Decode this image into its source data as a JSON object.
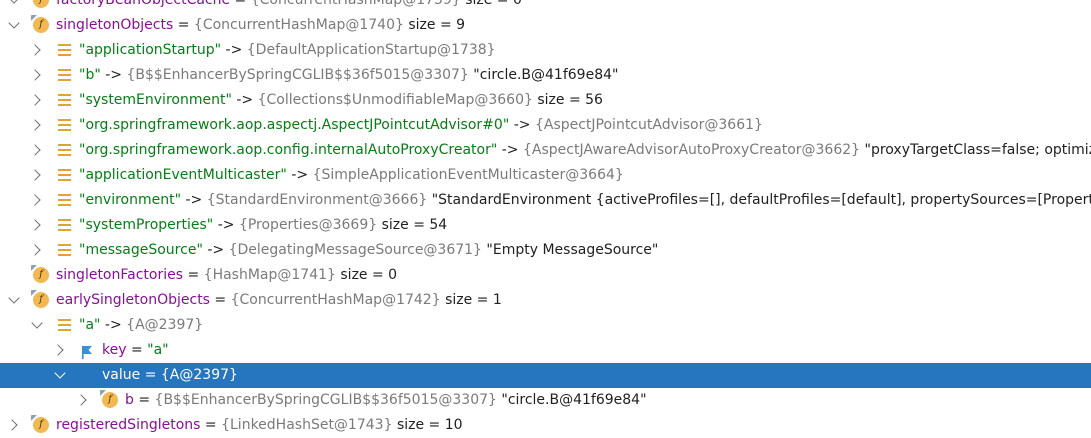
{
  "rows": [
    {
      "indent": 1,
      "arrow": "expanded",
      "icon": "field",
      "name": "factoryBeanObjectCache",
      "ref": "{ConcurrentHashMap@1739}",
      "extra": "size = 0",
      "partial": true
    },
    {
      "indent": 1,
      "arrow": "expanded",
      "icon": "field",
      "name": "singletonObjects",
      "ref": "{ConcurrentHashMap@1740}",
      "extra": "size = 9"
    },
    {
      "indent": 2,
      "arrow": "collapsed",
      "icon": "map",
      "key": "\"applicationStartup\"",
      "ref": "{DefaultApplicationStartup@1738}"
    },
    {
      "indent": 2,
      "arrow": "collapsed",
      "icon": "map",
      "key": "\"b\"",
      "ref": "{B$$EnhancerBySpringCGLIB$$36f5015@3307}",
      "extra": "\"circle.B@41f69e84\""
    },
    {
      "indent": 2,
      "arrow": "collapsed",
      "icon": "map",
      "key": "\"systemEnvironment\"",
      "ref": "{Collections$UnmodifiableMap@3660}",
      "extra": "size = 56"
    },
    {
      "indent": 2,
      "arrow": "collapsed",
      "icon": "map",
      "key": "\"org.springframework.aop.aspectj.AspectJPointcutAdvisor#0\"",
      "ref": "{AspectJPointcutAdvisor@3661}"
    },
    {
      "indent": 2,
      "arrow": "collapsed",
      "icon": "map",
      "key": "\"org.springframework.aop.config.internalAutoProxyCreator\"",
      "ref": "{AspectJAwareAdvisorAutoProxyCreator@3662}",
      "extra": "\"proxyTargetClass=false; optimize=false; opaque=false; exposeProxy=false; frozen=false\""
    },
    {
      "indent": 2,
      "arrow": "collapsed",
      "icon": "map",
      "key": "\"applicationEventMulticaster\"",
      "ref": "{SimpleApplicationEventMulticaster@3664}"
    },
    {
      "indent": 2,
      "arrow": "collapsed",
      "icon": "map",
      "key": "\"environment\"",
      "ref": "{StandardEnvironment@3666}",
      "extra": "\"StandardEnvironment {activeProfiles=[], defaultProfiles=[default], propertySources=[PropertiesPropertySource {name='systemProperties'}]}\""
    },
    {
      "indent": 2,
      "arrow": "collapsed",
      "icon": "map",
      "key": "\"systemProperties\"",
      "ref": "{Properties@3669}",
      "extra": "size = 54"
    },
    {
      "indent": 2,
      "arrow": "collapsed",
      "icon": "map",
      "key": "\"messageSource\"",
      "ref": "{DelegatingMessageSource@3671}",
      "extra": "\"Empty MessageSource\""
    },
    {
      "indent": 1,
      "arrow": "none",
      "icon": "field",
      "name": "singletonFactories",
      "ref": "{HashMap@1741}",
      "extra": "size = 0"
    },
    {
      "indent": 1,
      "arrow": "expanded",
      "icon": "field",
      "name": "earlySingletonObjects",
      "ref": "{ConcurrentHashMap@1742}",
      "extra": "size = 1"
    },
    {
      "indent": 2,
      "arrow": "expanded",
      "icon": "map",
      "key": "\"a\"",
      "ref": "{A@2397}"
    },
    {
      "indent": 3,
      "arrow": "collapsed",
      "icon": "flag",
      "name": "key",
      "eq": true,
      "key": "\"a\""
    },
    {
      "indent": 3,
      "arrow": "expanded",
      "icon": "none",
      "name": "value",
      "eq": true,
      "ref": "{A@2397}",
      "selected": true
    },
    {
      "indent": 4,
      "arrow": "collapsed",
      "icon": "field",
      "name": "b",
      "eq": true,
      "ref": "{B$$EnhancerBySpringCGLIB$$36f5015@3307}",
      "extra": "\"circle.B@41f69e84\""
    },
    {
      "indent": 1,
      "arrow": "collapsed",
      "icon": "field",
      "name": "registeredSingletons",
      "ref": "{LinkedHashSet@1743}",
      "extra": "size = 10",
      "partial": true
    }
  ],
  "symbols": {
    "eq": " = ",
    "arrow": " -> ",
    "field_letter": "f"
  },
  "colors": {
    "selection": "#2675bf",
    "field_name": "#871094",
    "string_key": "#067d17",
    "ref": "#7a7a7a",
    "field_icon": "#f2b851",
    "map_icon": "#e0a434",
    "flag_icon": "#3b8fd6"
  }
}
